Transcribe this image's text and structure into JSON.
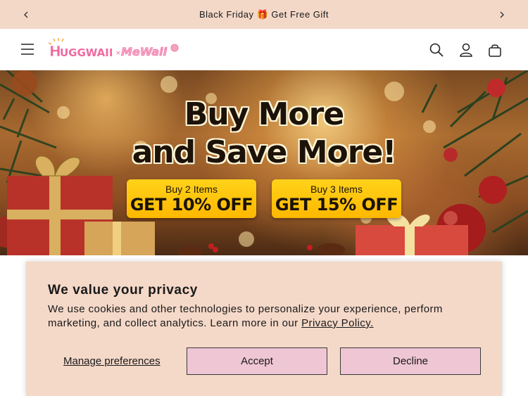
{
  "announcement": {
    "text": "Black Friday 🎁 Get Free Gift",
    "prev_label": "Previous announcement",
    "next_label": "Next announcement"
  },
  "header": {
    "logo_text": "HUGGWAII × MEWAII",
    "icons": [
      "menu-icon",
      "search-icon",
      "account-icon",
      "cart-icon"
    ]
  },
  "hero": {
    "title_line1": "Buy More",
    "title_line2": "and Save More!",
    "offers": [
      {
        "small": "Buy 2 Items",
        "big": "GET 10% OFF"
      },
      {
        "small": "Buy 3 Items",
        "big": "GET 15% OFF"
      }
    ]
  },
  "cookie": {
    "title": "We value your privacy",
    "body": "We use cookies and other technologies to personalize your experience, perform marketing, and collect analytics. Learn more in our ",
    "policy_link": "Privacy Policy.",
    "manage_label": "Manage preferences",
    "accept_label": "Accept",
    "decline_label": "Decline"
  },
  "colors": {
    "announcement_bg": "#f3d8c8",
    "cookie_bg": "#f4d8c8",
    "button_bg": "#efc6d4",
    "offer_yellow": "#ffc20a",
    "logo_pink": "#f06aa0"
  }
}
